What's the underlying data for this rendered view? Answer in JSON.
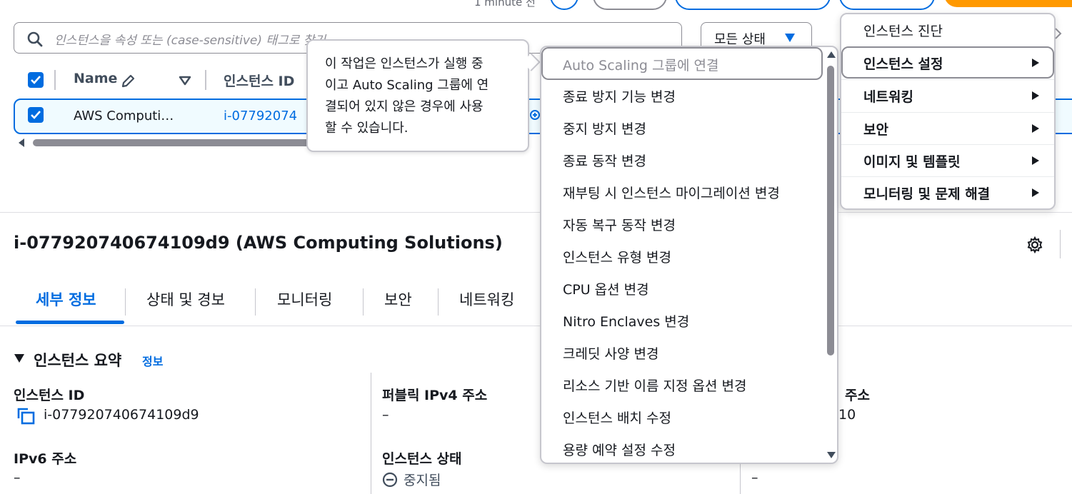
{
  "top": {
    "updated_text": "1 minute 전"
  },
  "search": {
    "placeholder": "인스턴스을 속성 또는 (case-sensitive) 태그로 찾기"
  },
  "state_filter": {
    "label": "모든 상태"
  },
  "table": {
    "headers": [
      "Name",
      "인스턴스 ID"
    ],
    "row": {
      "name": "AWS Computi…",
      "instance_id": "i-07792074"
    }
  },
  "tooltip": {
    "text": "이 작업은 인스턴스가 실행 중\n이고 Auto Scaling 그룹에 연\n결되어 있지 않은 경우에 사용\n할 수 있습니다."
  },
  "submenu": {
    "items": [
      "Auto Scaling 그룹에 연결",
      "종료 방지 기능 변경",
      "중지 방지 변경",
      "종료 동작 변경",
      "재부팅 시 인스턴스 마이그레이션 변경",
      "자동 복구 동작 변경",
      "인스턴스 유형 변경",
      "CPU 옵션 변경",
      "Nitro Enclaves 변경",
      "크레딧 사양 변경",
      "리소스 기반 이름 지정 옵션 변경",
      "인스턴스 배치 수정",
      "용량 예약 설정 수정"
    ]
  },
  "mainmenu": {
    "items": [
      "인스턴스 진단",
      "인스턴스 설정",
      "네트워킹",
      "보안",
      "이미지 및 템플릿",
      "모니터링 및 문제 해결"
    ]
  },
  "detail": {
    "title": "i-077920740674109d9 (AWS Computing Solutions)",
    "tabs": [
      "세부 정보",
      "상태 및 경보",
      "모니터링",
      "보안",
      "네트워킹"
    ],
    "section_title": "인스턴스 요약",
    "info_link": "정보",
    "fields": {
      "instance_id_label": "인스턴스 ID",
      "instance_id_value": "i-077920740674109d9",
      "public_ipv4_label": "퍼블릭 IPv4 주소",
      "public_ipv4_value": "–",
      "private_ip_label_partial": "주소",
      "private_ip_value_partial": "10",
      "ipv6_label": "IPv6 주소",
      "ipv6_value": "–",
      "state_label": "인스턴스 상태",
      "state_value": "중지됨",
      "third_col_value": "–"
    }
  }
}
